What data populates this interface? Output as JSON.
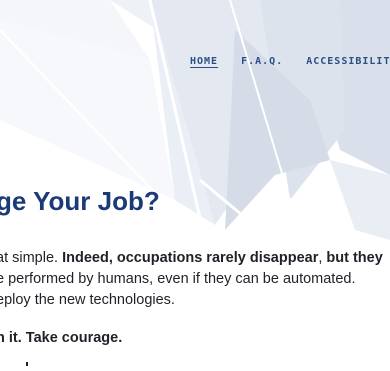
{
  "nav": {
    "home": "HOME",
    "faq": "F.A.Q.",
    "accessibility": "ACCESSIBILITY"
  },
  "colors": {
    "nav_text": "#2a4f86",
    "headline": "#1b3b77",
    "body_text": "#1e2127",
    "background_shape": "#dfe5ef"
  },
  "main": {
    "headline": "ge Your Job?",
    "line1_a": "at simple. ",
    "line1_b": "Indeed, occupations rarely disappear",
    "line1_c": ", ",
    "line1_d": "but they",
    "line2": "e performed by humans, even if they can be automated.",
    "line3": "eploy the new technologies.",
    "closing": "h it. Take courage."
  }
}
